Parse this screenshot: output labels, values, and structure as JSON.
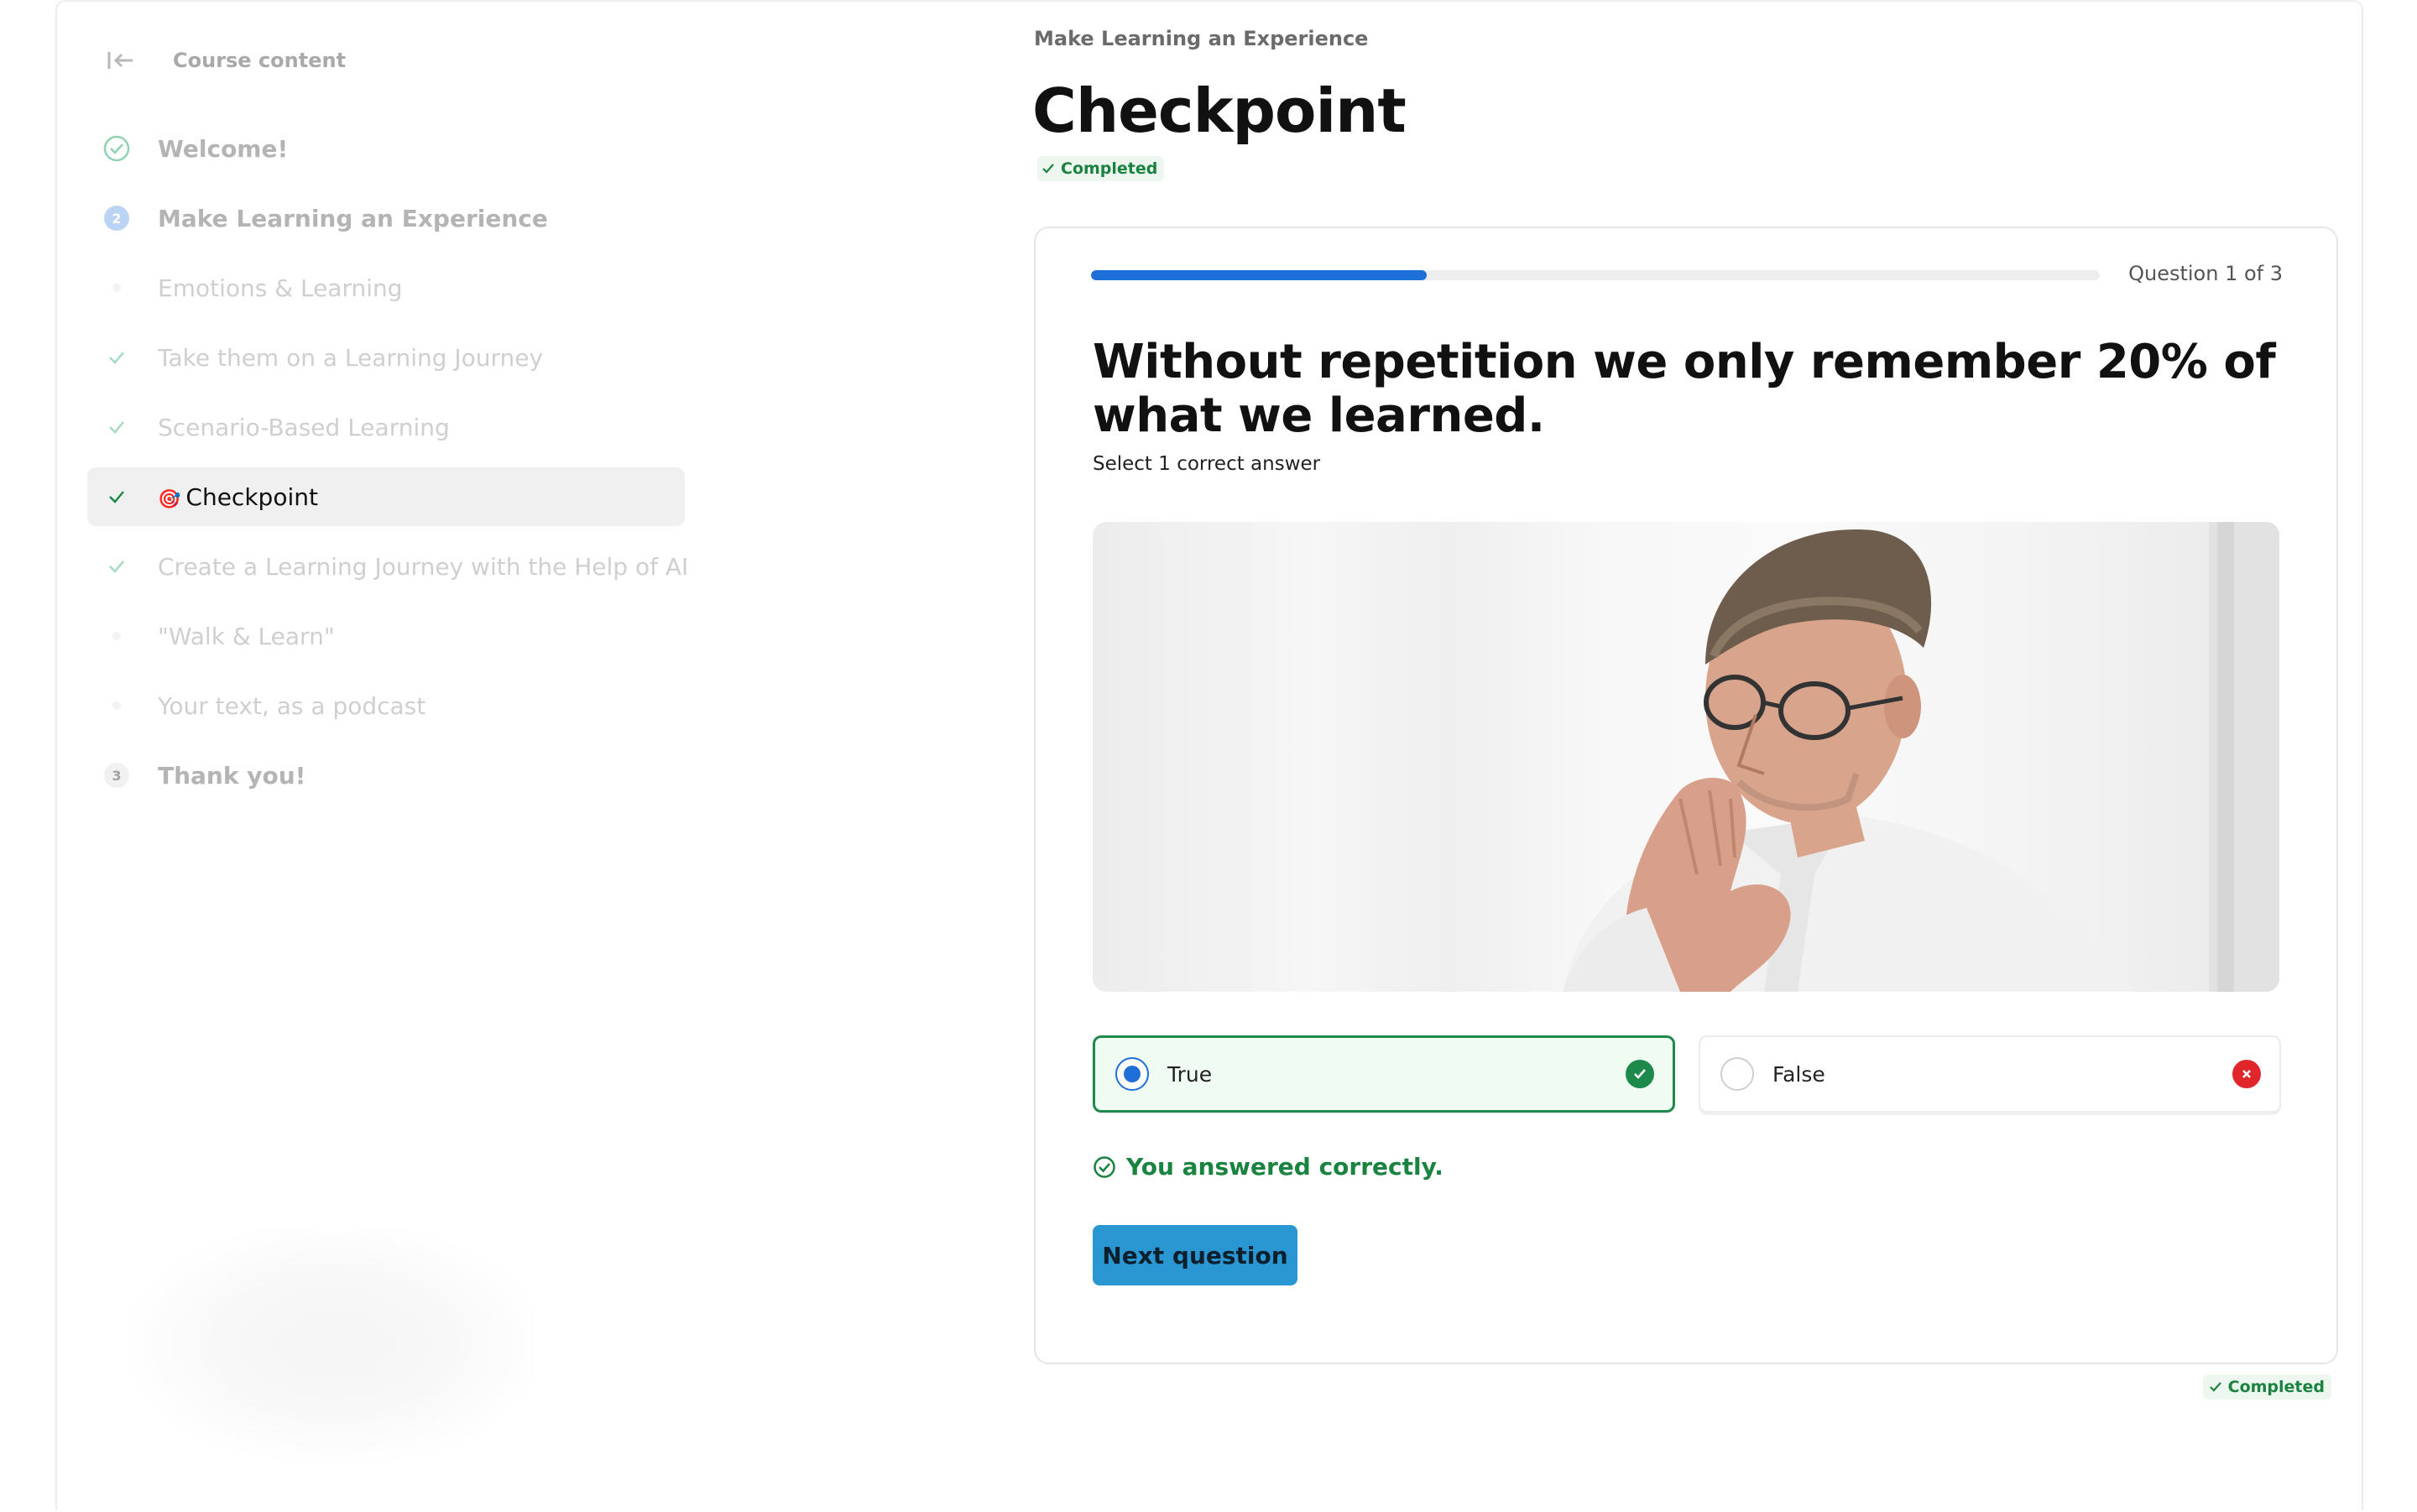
{
  "sidebar": {
    "title": "Course content",
    "items": [
      {
        "label": "Welcome!",
        "icon": "check-circle-icon",
        "kind": "section"
      },
      {
        "label": "Make Learning an Experience",
        "icon": "step-2-icon",
        "badge": "2",
        "kind": "section"
      },
      {
        "label": "Emotions & Learning",
        "icon": "dot-icon",
        "kind": "sub"
      },
      {
        "label": "Take them on a Learning Journey",
        "icon": "check-icon",
        "kind": "sub"
      },
      {
        "label": "Scenario-Based Learning",
        "icon": "check-icon",
        "kind": "sub"
      },
      {
        "label": "Checkpoint",
        "icon": "check-icon",
        "emoji": "🎯",
        "kind": "sub",
        "active": true
      },
      {
        "label": "Create a Learning Journey with the Help of AI",
        "icon": "check-icon",
        "kind": "sub"
      },
      {
        "label": "\"Walk & Learn\"",
        "icon": "dot-icon",
        "kind": "sub"
      },
      {
        "label": "Your text, as a podcast",
        "icon": "dot-icon",
        "kind": "sub"
      },
      {
        "label": "Thank you!",
        "icon": "step-3-icon",
        "badge": "3",
        "kind": "section"
      }
    ]
  },
  "main": {
    "breadcrumb": "Make Learning an Experience",
    "title": "Checkpoint",
    "status": "Completed",
    "question": {
      "progress": 0.333,
      "counter": "Question 1 of 3",
      "text": "Without repetition we only remember 20% of what we learned.",
      "hint": "Select 1 correct answer",
      "answers": [
        {
          "label": "True",
          "selected": true,
          "result": "correct"
        },
        {
          "label": "False",
          "selected": false,
          "result": "incorrect"
        }
      ],
      "feedback": "You answered correctly.",
      "next_label": "Next question"
    },
    "footer_status": "Completed"
  },
  "colors": {
    "accent": "#1f6fd8",
    "success": "#1d8a4c",
    "error": "#e0262b",
    "button": "#2a97d3"
  }
}
